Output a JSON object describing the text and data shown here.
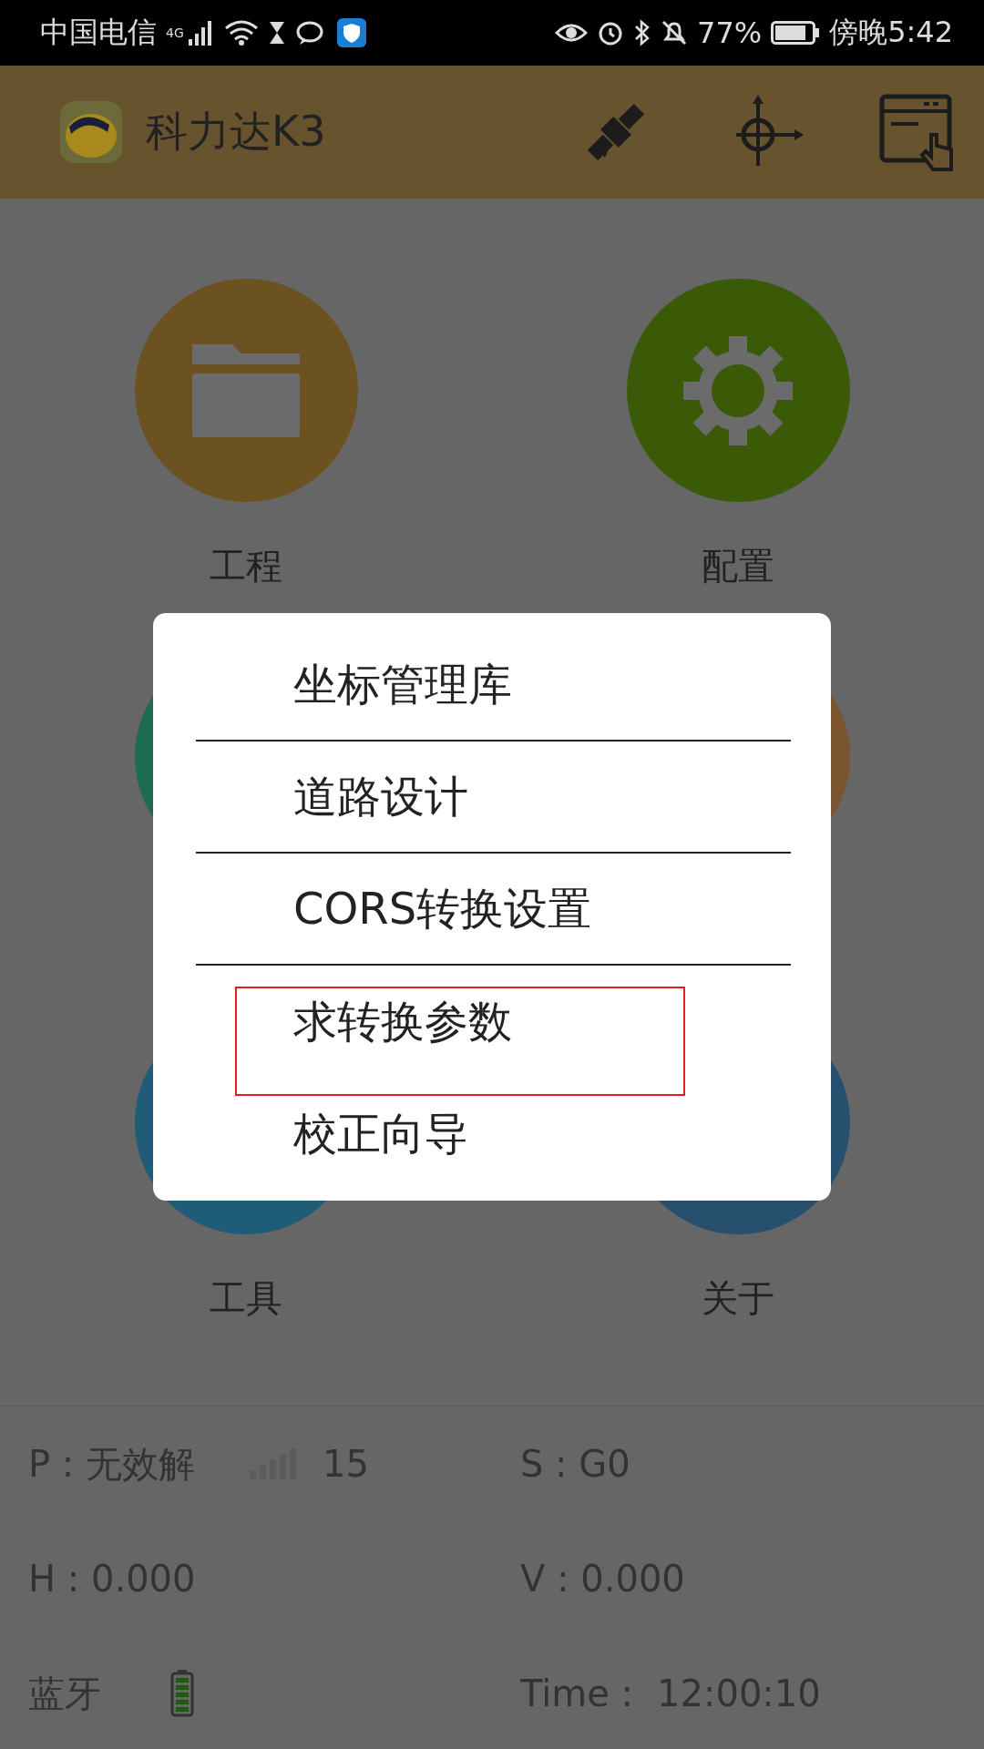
{
  "status_bar": {
    "carrier": "中国电信",
    "network": "4G",
    "battery_percent": "77%",
    "time": "傍晚5:42"
  },
  "app_bar": {
    "title": "科力达K3"
  },
  "tiles": [
    {
      "label": "工程",
      "color": "#6b5220"
    },
    {
      "label": "配置",
      "color": "#3a5a08"
    },
    {
      "color": "#1d6b55"
    },
    {
      "color": "#7a5530"
    },
    {
      "label": "工具",
      "color": "#1f5c78"
    },
    {
      "label": "关于",
      "color": "#27506e"
    }
  ],
  "info": {
    "position_label": "P : 无效解",
    "satellite_count": "15",
    "status": "S : G0",
    "h": "H : 0.000",
    "v": "V : 0.000",
    "bluetooth": "蓝牙",
    "time_label": "Time :",
    "time_value": "12:00:10"
  },
  "menu": {
    "items": [
      {
        "label": "坐标管理库",
        "divider": true,
        "highlighted": false
      },
      {
        "label": "道路设计",
        "divider": true,
        "highlighted": false
      },
      {
        "label": "CORS转换设置",
        "divider": true,
        "highlighted": false
      },
      {
        "label": "求转换参数",
        "divider": false,
        "highlighted": true
      },
      {
        "label": "校正向导",
        "divider": false,
        "highlighted": false
      }
    ]
  }
}
